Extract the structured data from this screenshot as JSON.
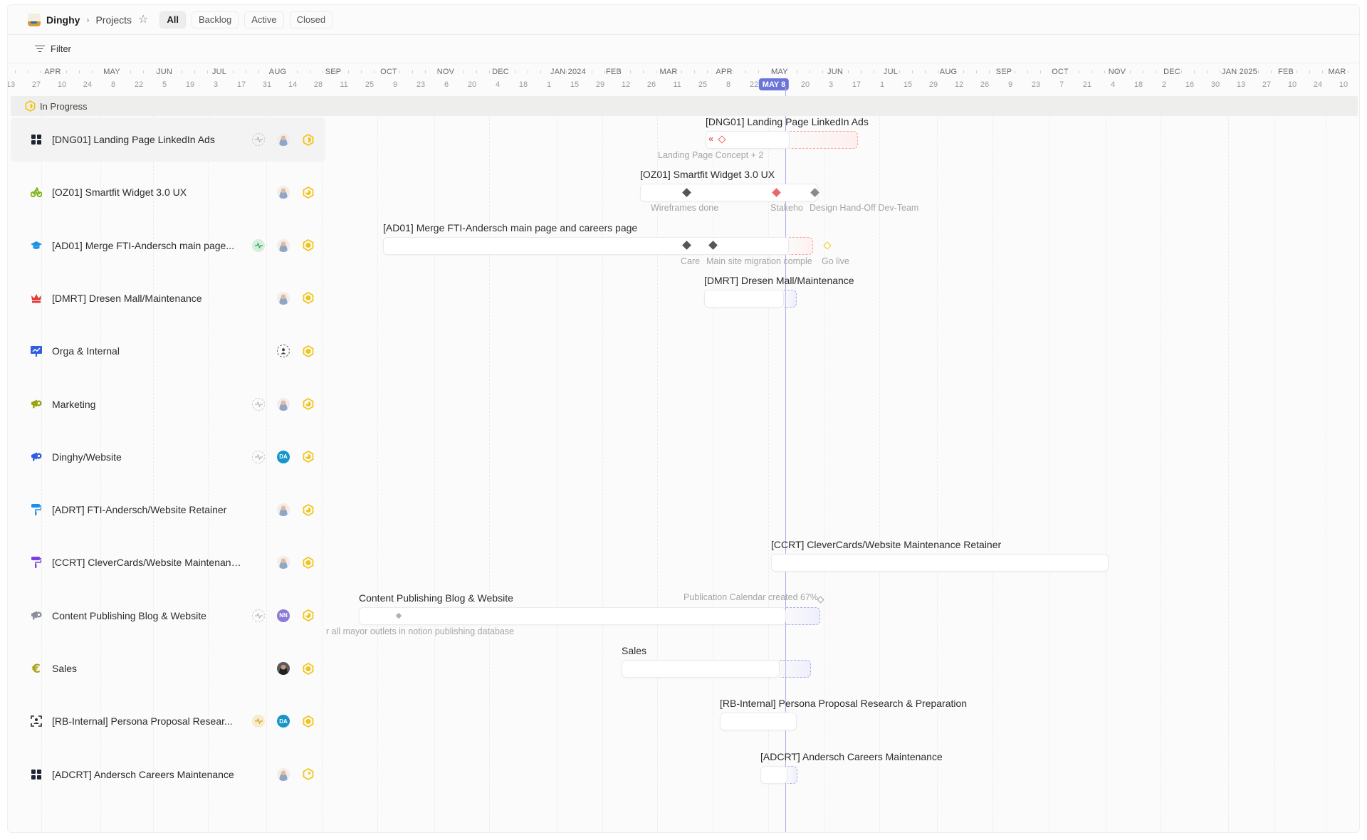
{
  "topbar": {
    "workspace": "Dinghy",
    "page": "Projects",
    "star_icon": "star-outline-icon",
    "tabs": [
      {
        "label": "All",
        "active": true
      },
      {
        "label": "Backlog",
        "active": false
      },
      {
        "label": "Active",
        "active": false
      },
      {
        "label": "Closed",
        "active": false
      }
    ]
  },
  "filterbar": {
    "label": "Filter"
  },
  "timeline": {
    "months": [
      "APR",
      "MAY",
      "JUN",
      "JUL",
      "AUG",
      "SEP",
      "OCT",
      "NOV",
      "DEC",
      "JAN 2024",
      "FEB",
      "MAR",
      "APR",
      "MAY",
      "JUN",
      "JUL",
      "AUG",
      "SEP",
      "OCT",
      "NOV",
      "DEC",
      "JAN 2025",
      "FEB",
      "MAR"
    ],
    "days": [
      "13",
      "27",
      "10",
      "24",
      "8",
      "22",
      "5",
      "19",
      "3",
      "17",
      "31",
      "14",
      "28",
      "11",
      "25",
      "9",
      "23",
      "6",
      "20",
      "4",
      "18",
      "1",
      "15",
      "29",
      "12",
      "26",
      "11",
      "25",
      "8",
      "22",
      "MAY 8",
      "20",
      "3",
      "17",
      "1",
      "15",
      "29",
      "12",
      "26",
      "9",
      "23",
      "7",
      "21",
      "4",
      "18",
      "2",
      "16",
      "30",
      "13",
      "27",
      "10",
      "24",
      "10"
    ],
    "today_label": "MAY 8",
    "today_color": "#6b74d8"
  },
  "group": {
    "label": "In Progress",
    "status_color": "#f0c419"
  },
  "colors": {
    "status_yellow": "#f0c419",
    "health_green": "#3aa65a",
    "today_line": "#a9aee8",
    "milestone_dark": "#555555",
    "milestone_red": "#e86a6a",
    "milestone_yellow": "#f0c419"
  },
  "projects": [
    {
      "title": "[DNG01] Landing Page LinkedIn Ads",
      "icon": "grid-icon",
      "icon_color": "#1d2433",
      "health": "empty",
      "lead": "photo",
      "status": "half",
      "bar_title": "[DNG01] Landing Page LinkedIn Ads",
      "milestone_label": "Landing Page Concept + 2"
    },
    {
      "title": "[OZ01] Smartfit Widget 3.0 UX",
      "icon": "bike-icon",
      "icon_color": "#7cb518",
      "health": "none",
      "lead": "photo",
      "status": "mostly",
      "bar_title": "[OZ01] Smartfit Widget 3.0 UX",
      "milestones": [
        "Wireframes done",
        "Stakeho",
        "Design Hand-Off Dev-Team"
      ]
    },
    {
      "title": "[AD01] Merge FTI-Andersch main page...",
      "icon": "graduation-cap-icon",
      "icon_color": "#1e90e8",
      "health": "good",
      "lead": "photo",
      "status": "full",
      "bar_title": "[AD01] Merge FTI-Andersch main page and careers page",
      "milestones": [
        "Care",
        "Main site migration comple",
        "Go live"
      ]
    },
    {
      "title": "[DMRT] Dresen Mall/Maintenance",
      "icon": "crown-icon",
      "icon_color": "#e53935",
      "health": "none",
      "lead": "photo",
      "status": "full",
      "bar_title": "[DMRT] Dresen Mall/Maintenance"
    },
    {
      "title": "Orga & Internal",
      "icon": "presentation-chart-icon",
      "icon_color": "#2f5fe0",
      "health": "none",
      "lead": "dashed",
      "status": "full"
    },
    {
      "title": "Marketing",
      "icon": "megaphone-icon",
      "icon_color": "#9aa316",
      "health": "empty",
      "lead": "photo",
      "status": "mostly"
    },
    {
      "title": "Dinghy/Website",
      "icon": "megaphone-icon",
      "icon_color": "#2f5fe0",
      "health": "empty",
      "lead": "initials",
      "lead_initials": "DA",
      "lead_color": "#1696c8",
      "status": "mostly"
    },
    {
      "title": "[ADRT] FTI-Andersch/Website Retainer",
      "icon": "paint-roller-icon",
      "icon_color": "#1e90e8",
      "health": "none",
      "lead": "photo",
      "status": "mostly"
    },
    {
      "title": "[CCRT] CleverCards/Website Maintenance R...",
      "icon": "paint-roller-icon",
      "icon_color": "#7b3fe4",
      "health": "none",
      "lead": "photo",
      "status": "full",
      "bar_title": "[CCRT] CleverCards/Website Maintenance Retainer"
    },
    {
      "title": "Content Publishing Blog & Website",
      "icon": "megaphone-icon",
      "icon_color": "#8a8f99",
      "health": "empty",
      "lead": "initials",
      "lead_initials": "NN",
      "lead_color": "#8e7bd6",
      "status": "mostly",
      "bar_title": "Content Publishing Blog & Website",
      "milestone_label": "r all mayor outlets in notion publishing database",
      "milestone_right": "Publication Calendar created 67%"
    },
    {
      "title": "Sales",
      "icon": "euro-icon",
      "icon_color": "#a8a31c",
      "health": "none",
      "lead": "photo-dark",
      "status": "full",
      "bar_title": "Sales"
    },
    {
      "title": "[RB-Internal] Persona Proposal Resear...",
      "icon": "face-scan-icon",
      "icon_color": "#2b2b2b",
      "health": "warn",
      "lead": "initials",
      "lead_initials": "DA",
      "lead_color": "#1696c8",
      "status": "full",
      "bar_title": "[RB-Internal] Persona Proposal Research & Preparation"
    },
    {
      "title": "[ADCRT] Andersch Careers Maintenance",
      "icon": "grid-icon",
      "icon_color": "#1d2433",
      "health": "none",
      "lead": "photo",
      "status": "quarter",
      "bar_title": "[ADCRT] Andersch Careers Maintenance"
    }
  ]
}
